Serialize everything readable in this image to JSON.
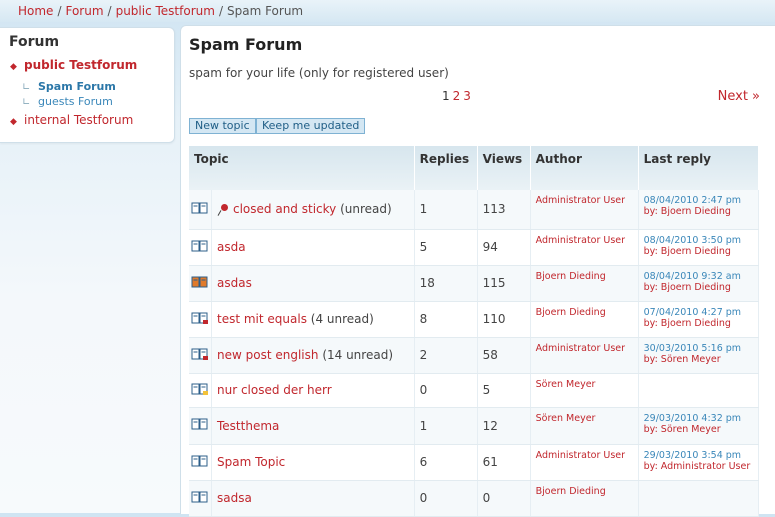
{
  "breadcrumb": {
    "home": "Home",
    "forum": "Forum",
    "public": "public Testforum",
    "current": "Spam Forum",
    "sep": "/"
  },
  "sidebar": {
    "title": "Forum",
    "items": [
      {
        "label": "public Testforum"
      },
      {
        "label": "Spam Forum"
      },
      {
        "label": "guests Forum"
      },
      {
        "label": "internal Testforum"
      }
    ]
  },
  "main": {
    "title": "Spam Forum",
    "description": "spam for your life (only for registered user)",
    "pages": [
      "1",
      "2",
      "3"
    ],
    "next_label": "Next »",
    "new_topic_label": "New topic",
    "keep_updated_label": "Keep me updated"
  },
  "table": {
    "headers": {
      "topic": "Topic",
      "replies": "Replies",
      "views": "Views",
      "author": "Author",
      "last_reply": "Last reply"
    },
    "rows": [
      {
        "title": "closed and sticky",
        "unread": "(unread)",
        "replies": "1",
        "views": "113",
        "author": "Administrator User",
        "last_date": "08/04/2010 2:47 pm",
        "last_by": "by: Bjoern Dieding",
        "icon": "book-closed-icon",
        "sticky": true
      },
      {
        "title": "asda",
        "unread": "",
        "replies": "5",
        "views": "94",
        "author": "Administrator User",
        "last_date": "08/04/2010 3:50 pm",
        "last_by": "by: Bjoern Dieding",
        "icon": "book-icon"
      },
      {
        "title": "asdas",
        "unread": "",
        "replies": "18",
        "views": "115",
        "author": "Bjoern Dieding",
        "last_date": "08/04/2010 9:32 am",
        "last_by": "by: Bjoern Dieding",
        "icon": "book-hot-icon"
      },
      {
        "title": "test mit equals",
        "unread": "(4 unread)",
        "replies": "8",
        "views": "110",
        "author": "Bjoern Dieding",
        "last_date": "07/04/2010 4:27 pm",
        "last_by": "by: Bjoern Dieding",
        "icon": "book-new-icon"
      },
      {
        "title": "new post english",
        "unread": "(14 unread)",
        "replies": "2",
        "views": "58",
        "author": "Administrator User",
        "last_date": "30/03/2010 5:16 pm",
        "last_by": "by: Sören Meyer",
        "icon": "book-new-icon"
      },
      {
        "title": "nur closed der herr",
        "unread": "",
        "replies": "0",
        "views": "5",
        "author": "Sören Meyer",
        "last_date": "",
        "last_by": "",
        "icon": "book-locked-icon"
      },
      {
        "title": "Testthema",
        "unread": "",
        "replies": "1",
        "views": "12",
        "author": "Sören Meyer",
        "last_date": "29/03/2010 4:32 pm",
        "last_by": "by: Sören Meyer",
        "icon": "book-icon"
      },
      {
        "title": "Spam Topic",
        "unread": "",
        "replies": "6",
        "views": "61",
        "author": "Administrator User",
        "last_date": "29/03/2010 3:54 pm",
        "last_by": "by: Administrator User",
        "icon": "book-icon"
      },
      {
        "title": "sadsa",
        "unread": "",
        "replies": "0",
        "views": "0",
        "author": "Bjoern Dieding",
        "last_date": "",
        "last_by": "",
        "icon": "book-icon"
      }
    ]
  },
  "colors": {
    "link": "#c1272d",
    "accent_blue": "#3a87b9",
    "button_bg": "#d4e7f3"
  }
}
